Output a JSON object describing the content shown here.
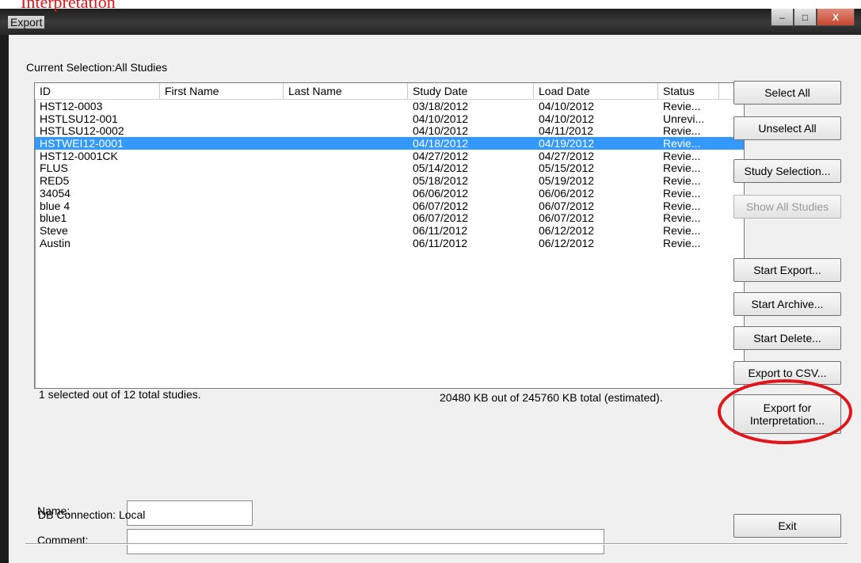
{
  "annotation": {
    "text": "Interpretation",
    "color": "#e0161b"
  },
  "window": {
    "title": "Export",
    "minimize": "–",
    "maximize": "□",
    "close": "X"
  },
  "selection": {
    "label": "Current Selection:",
    "value": "All Studies"
  },
  "table": {
    "columns": [
      "ID",
      "First Name",
      "Last Name",
      "Study Date",
      "Load Date",
      "Status"
    ],
    "rows": [
      {
        "id": "HST12-0003",
        "first": "",
        "last": "",
        "study": "03/18/2012",
        "load": "04/10/2012",
        "status": "Revie...",
        "selected": false
      },
      {
        "id": "HSTLSU12-001",
        "first": "",
        "last": "",
        "study": "04/10/2012",
        "load": "04/10/2012",
        "status": "Unrevi...",
        "selected": false
      },
      {
        "id": "HSTLSU12-0002",
        "first": "",
        "last": "",
        "study": "04/10/2012",
        "load": "04/11/2012",
        "status": "Revie...",
        "selected": false
      },
      {
        "id": "HSTWEI12-0001",
        "first": "",
        "last": "",
        "study": "04/18/2012",
        "load": "04/19/2012",
        "status": "Revie...",
        "selected": true
      },
      {
        "id": "HST12-0001CK",
        "first": "",
        "last": "",
        "study": "04/27/2012",
        "load": "04/27/2012",
        "status": "Revie...",
        "selected": false
      },
      {
        "id": "FLUS",
        "first": "",
        "last": "",
        "study": "05/14/2012",
        "load": "05/15/2012",
        "status": "Revie...",
        "selected": false
      },
      {
        "id": "RED5",
        "first": "",
        "last": "",
        "study": "05/18/2012",
        "load": "05/19/2012",
        "status": "Revie...",
        "selected": false
      },
      {
        "id": "34054",
        "first": "",
        "last": "",
        "study": "06/06/2012",
        "load": "06/06/2012",
        "status": "Revie...",
        "selected": false
      },
      {
        "id": "blue 4",
        "first": "",
        "last": "",
        "study": "06/07/2012",
        "load": "06/07/2012",
        "status": "Revie...",
        "selected": false
      },
      {
        "id": "blue1",
        "first": "",
        "last": "",
        "study": "06/07/2012",
        "load": "06/07/2012",
        "status": "Revie...",
        "selected": false
      },
      {
        "id": "Steve",
        "first": "",
        "last": "",
        "study": "06/11/2012",
        "load": "06/12/2012",
        "status": "Revie...",
        "selected": false
      },
      {
        "id": "Austin",
        "first": "",
        "last": "",
        "study": "06/11/2012",
        "load": "06/12/2012",
        "status": "Revie...",
        "selected": false
      }
    ]
  },
  "summary": {
    "selected_count": "1 selected out of 12 total studies.",
    "size": "20480 KB out of 245760 KB total (estimated)."
  },
  "buttons": {
    "select_all": "Select All",
    "unselect_all": "Unselect All",
    "study_selection": "Study Selection...",
    "show_all_studies": "Show All Studies",
    "start_export": "Start Export...",
    "start_archive": "Start Archive...",
    "start_delete": "Start Delete...",
    "export_csv": "Export to CSV...",
    "export_interp_line1": "Export for",
    "export_interp_line2": "Interpretation...",
    "exit": "Exit"
  },
  "form": {
    "name_label": "Name:",
    "name_value": "",
    "comment_label": "Comment:",
    "comment_value": ""
  },
  "status": {
    "db_connection": "DB Connection: Local"
  },
  "colors": {
    "selection": "#3399ff",
    "annotation_circle": "#e0161b"
  }
}
